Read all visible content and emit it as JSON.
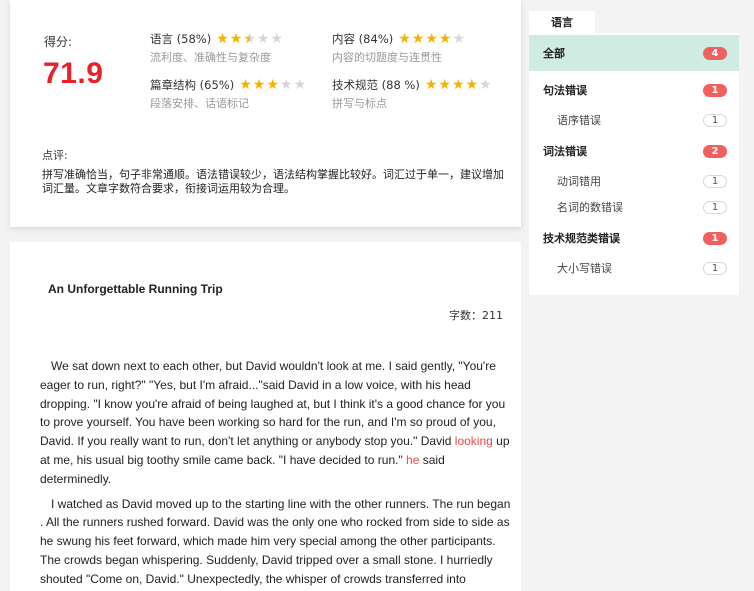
{
  "score": {
    "label": "得分:",
    "value": "71.9"
  },
  "metrics": [
    {
      "title": "语言 (58%)",
      "sub": "流利度、准确性与复杂度",
      "stars": 2.5
    },
    {
      "title": "内容 (84%)",
      "sub": "内容的切题度与连贯性",
      "stars": 4
    },
    {
      "title": "篇章结构 (65%)",
      "sub": "段落安排、话语标记",
      "stars": 3
    },
    {
      "title": "技术规范 (88 %)",
      "sub": "拼写与标点",
      "stars": 4
    }
  ],
  "comment": {
    "label": "点评:",
    "text": "拼写准确恰当，句子非常通顺。语法错误较少，语法结构掌握比较好。词汇过于单一，建议增加词汇量。文章字数符合要求，衔接词运用较为合理。"
  },
  "essay": {
    "title": "An Unforgettable Running Trip",
    "word_count": "字数：211",
    "p1": {
      "a": "We sat down next to each other, but David wouldn't look at me.   I said gently, \"You're eager to run, right?\"   \"Yes, but I'm afraid...\"said David in a low voice, with his head dropping.   \"I know you're afraid of being laughed at, but I think it's a good chance for you to prove yourself.   You have been working so hard for the run, and I'm so proud of you, David.   If you really want to run, don't let anything or anybody stop you.\"   David ",
      "hl1": "looking",
      "b": " up at me, his usual big toothy smile came back.   \"I have decided to run.\"   ",
      "hl2": "he",
      "c": " said determinedly."
    },
    "p2": "I watched as David moved up to the starting line with the other runners.   The run began .   All the runners rushed forward.   David was the only one who rocked from side to side as he swung his feet forward, which made him very special among the other participants. The crowds began whispering.   Suddenly, David tripped over a small stone.   I hurriedly shouted \"Come on, David.\"   Unexpectedly, the whisper of crowds transferred into"
  },
  "errors": {
    "tab": "语言",
    "all": {
      "label": "全部",
      "count": "4"
    },
    "groups": [
      {
        "label": "句法错误",
        "count": "1",
        "items": [
          {
            "label": "语序错误",
            "count": "1"
          }
        ]
      },
      {
        "label": "词法错误",
        "count": "2",
        "items": [
          {
            "label": "动词错用",
            "count": "1"
          },
          {
            "label": "名词的数错误",
            "count": "1"
          }
        ]
      },
      {
        "label": "技术规范类错误",
        "count": "1",
        "items": [
          {
            "label": "大小写错误",
            "count": "1"
          }
        ]
      }
    ]
  },
  "colors": {
    "score": "#e8202a",
    "star_on": "#f5b300",
    "star_off": "#d6d6d6",
    "highlight": "#e84a4a",
    "badge_red": "#f06060",
    "active_row": "#cfece2"
  }
}
